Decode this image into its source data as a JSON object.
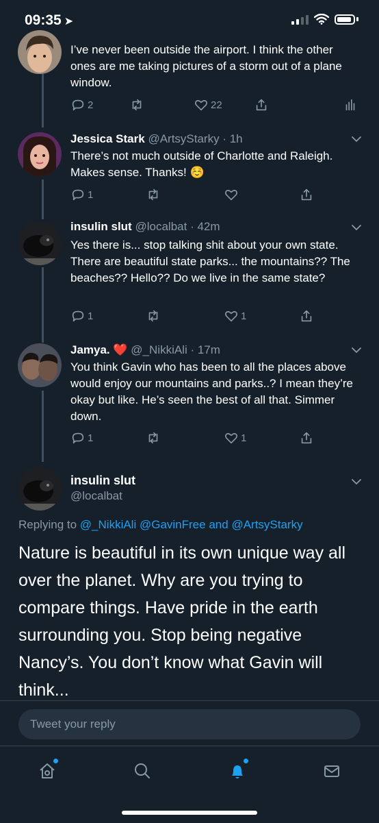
{
  "status_bar": {
    "time": "09:35",
    "location_glyph": "➤"
  },
  "colors": {
    "background": "#15202b",
    "accent": "#1da1f2",
    "muted": "#8899a6",
    "like_red": "#e0245e"
  },
  "tweets": [
    {
      "text": "I’ve never been outside the airport. I think the other ones are me taking pictures of a storm out of a plane window.",
      "replies": "2",
      "retweets": "",
      "likes": "22"
    },
    {
      "name": "Jessica Stark",
      "handle": "@ArtsyStarky",
      "time": "· 1h",
      "text": "There’s not much outside of Charlotte and Raleigh. Makes sense. Thanks! ☺️",
      "replies": "1",
      "retweets": "",
      "likes": ""
    },
    {
      "name": "insulin slut",
      "handle": "@localbat",
      "time": "· 42m",
      "text": "Yes there is... stop talking shit about your own state. There are beautiful state parks... the mountains?? The beaches?? Hello?? Do we live in the same state?",
      "replies": "1",
      "retweets": "",
      "likes": "1"
    },
    {
      "name": "Jamya. ❤️",
      "handle": "@_NikkiAli",
      "time": "· 17m",
      "text": "You think Gavin who has been to all the places above would enjoy our mountains and parks..? I mean they’re okay but like. He’s seen the best of all that. Simmer down.",
      "replies": "1",
      "retweets": "",
      "likes": "1"
    }
  ],
  "main_tweet": {
    "name": "insulin slut",
    "handle": "@localbat",
    "replying_prefix": "Replying to",
    "mention1": "@_NikkiAli",
    "mention2": "@GavinFree",
    "and_word": "and",
    "mention3": "@ArtsyStarky",
    "text": "Nature is beautiful in its own unique way all over the planet. Why are you trying to compare things. Have pride in the earth surrounding you. Stop being negative Nancy’s. You don’t know what Gavin will think..."
  },
  "reply_bar": {
    "placeholder": "Tweet your reply"
  },
  "tab_bar": {
    "tabs": [
      "home-icon",
      "search-icon",
      "notifications-icon",
      "messages-icon"
    ],
    "active": "notifications-icon"
  }
}
